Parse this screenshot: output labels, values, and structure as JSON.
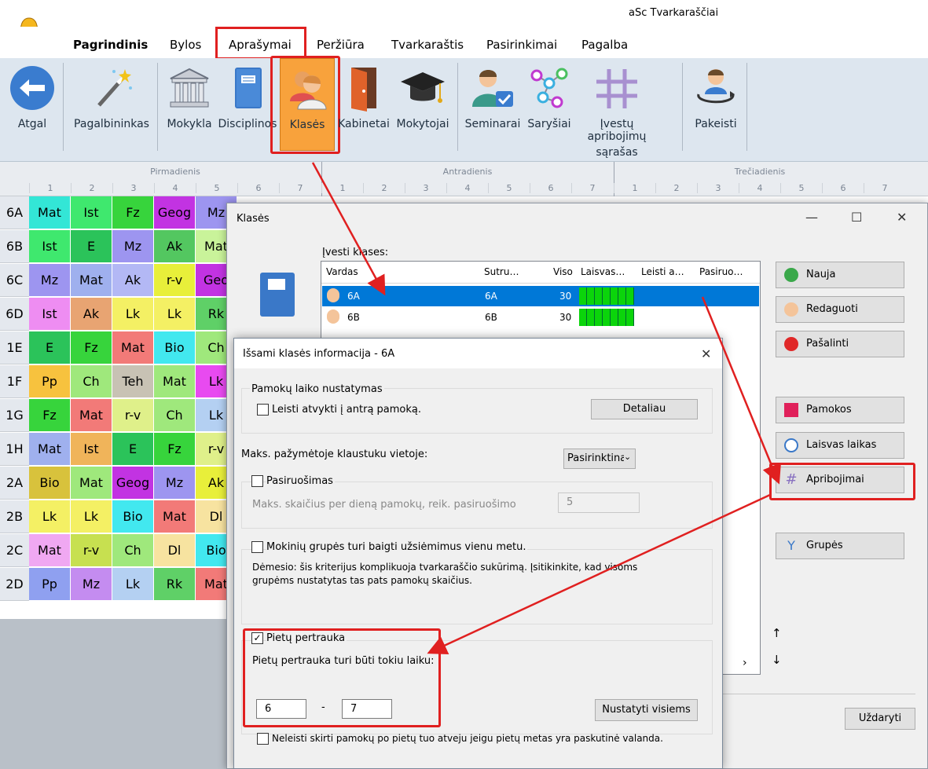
{
  "app": {
    "title": "aSc Tvarkaraščiai"
  },
  "menu": {
    "items": [
      "Pagrindinis",
      "Bylos",
      "Aprašymai",
      "Peržiūra",
      "Tvarkaraštis",
      "Pasirinkimai",
      "Pagalba"
    ]
  },
  "ribbon": {
    "back": "Atgal",
    "wizard": "Pagalbininkas",
    "school": "Mokykla",
    "subjects": "Disciplinos",
    "classes": "Klasės",
    "rooms": "Kabinetai",
    "teachers": "Mokytojai",
    "seminars": "Seminarai",
    "links": "Saryšiai",
    "constraints_line1": "Įvestų apribojimų",
    "constraints_line2": "sąrašas",
    "replace": "Pakeisti"
  },
  "grid": {
    "days": [
      "Pirmadienis",
      "Antradienis",
      "Trečiadienis"
    ],
    "periods": [
      "1",
      "2",
      "3",
      "4",
      "5",
      "6",
      "7"
    ],
    "rows": [
      {
        "cls": "6A",
        "cells": [
          {
            "t": "Mat",
            "c": "#33e6d6"
          },
          {
            "t": "Ist",
            "c": "#3fe86e"
          },
          {
            "t": "Fz",
            "c": "#37d43c"
          },
          {
            "t": "Geog",
            "c": "#c233e2"
          },
          {
            "t": "Mz",
            "c": "#9d95f0"
          }
        ]
      },
      {
        "cls": "6B",
        "cells": [
          {
            "t": "Ist",
            "c": "#3fe86e"
          },
          {
            "t": "E",
            "c": "#2bc35a"
          },
          {
            "t": "Mz",
            "c": "#9d95f0"
          },
          {
            "t": "Ak",
            "c": "#53c760"
          },
          {
            "t": "Mat",
            "c": "#c9f39a"
          }
        ]
      },
      {
        "cls": "6C",
        "cells": [
          {
            "t": "Mz",
            "c": "#9d95f0"
          },
          {
            "t": "Mat",
            "c": "#9fb0ee"
          },
          {
            "t": "Ak",
            "c": "#b3b8f5"
          },
          {
            "t": "r-v",
            "c": "#e8ef3a"
          },
          {
            "t": "Geo",
            "c": "#c233e2"
          }
        ]
      },
      {
        "cls": "6D",
        "cells": [
          {
            "t": "Ist",
            "c": "#ee8df2"
          },
          {
            "t": "Ak",
            "c": "#e8a472"
          },
          {
            "t": "Lk",
            "c": "#f4f064"
          },
          {
            "t": "Lk",
            "c": "#f4f064"
          },
          {
            "t": "Rk",
            "c": "#5fd067"
          }
        ]
      },
      {
        "cls": "1E",
        "cells": [
          {
            "t": "E",
            "c": "#2bc35a"
          },
          {
            "t": "Fz",
            "c": "#37d43c"
          },
          {
            "t": "Mat",
            "c": "#f27a78"
          },
          {
            "t": "Bio",
            "c": "#42e8ef"
          },
          {
            "t": "Ch",
            "c": "#9fe87c"
          }
        ]
      },
      {
        "cls": "1F",
        "cells": [
          {
            "t": "Pp",
            "c": "#f7c23e"
          },
          {
            "t": "Ch",
            "c": "#9fe87c"
          },
          {
            "t": "Teh",
            "c": "#c8c2b4"
          },
          {
            "t": "Mat",
            "c": "#9fe87c"
          },
          {
            "t": "Lk",
            "c": "#e84af0"
          }
        ]
      },
      {
        "cls": "1G",
        "cells": [
          {
            "t": "Fz",
            "c": "#37d43c"
          },
          {
            "t": "Mat",
            "c": "#f27a78"
          },
          {
            "t": "r-v",
            "c": "#dff08a"
          },
          {
            "t": "Ch",
            "c": "#9fe87c"
          },
          {
            "t": "Lk",
            "c": "#b4d0f2"
          }
        ]
      },
      {
        "cls": "1H",
        "cells": [
          {
            "t": "Mat",
            "c": "#9fb0ee"
          },
          {
            "t": "Ist",
            "c": "#f0b45a"
          },
          {
            "t": "E",
            "c": "#2bc35a"
          },
          {
            "t": "Fz",
            "c": "#37d43c"
          },
          {
            "t": "r-v",
            "c": "#dff08a"
          }
        ]
      },
      {
        "cls": "2A",
        "cells": [
          {
            "t": "Bio",
            "c": "#d8c23c"
          },
          {
            "t": "Mat",
            "c": "#9fe87c"
          },
          {
            "t": "Geog",
            "c": "#c233e2"
          },
          {
            "t": "Mz",
            "c": "#9d95f0"
          },
          {
            "t": "Ak",
            "c": "#e8ef3a"
          }
        ]
      },
      {
        "cls": "2B",
        "cells": [
          {
            "t": "Lk",
            "c": "#f4f064"
          },
          {
            "t": "Lk",
            "c": "#f4f064"
          },
          {
            "t": "Bio",
            "c": "#42e8ef"
          },
          {
            "t": "Mat",
            "c": "#f27a78"
          },
          {
            "t": "Dl",
            "c": "#f7e3a0"
          }
        ]
      },
      {
        "cls": "2C",
        "cells": [
          {
            "t": "Mat",
            "c": "#f0a8f2"
          },
          {
            "t": "r-v",
            "c": "#c7e050"
          },
          {
            "t": "Ch",
            "c": "#9fe87c"
          },
          {
            "t": "Dl",
            "c": "#f7e3a0"
          },
          {
            "t": "Bio",
            "c": "#42e8ef"
          }
        ]
      },
      {
        "cls": "2D",
        "cells": [
          {
            "t": "Pp",
            "c": "#8fa0f0"
          },
          {
            "t": "Mz",
            "c": "#c48cf0"
          },
          {
            "t": "Lk",
            "c": "#b4d0f2"
          },
          {
            "t": "Rk",
            "c": "#5fd067"
          },
          {
            "t": "Mat",
            "c": "#f27a78"
          }
        ]
      }
    ]
  },
  "classes_dialog": {
    "title": "Klasės",
    "list_label": "Įvesti klases:",
    "columns": [
      "Vardas",
      "Sutru…",
      "Viso",
      "Laisvas…",
      "Leisti a…",
      "Pasiruo…"
    ],
    "rows": [
      {
        "name": "6A",
        "short": "6A",
        "total": "30"
      },
      {
        "name": "6B",
        "short": "6B",
        "total": "30"
      }
    ],
    "buttons": {
      "new": "Nauja",
      "edit": "Redaguoti",
      "delete": "Pašalinti",
      "lessons": "Pamokos",
      "free_time": "Laisvas laikas",
      "constraints": "Apribojimai",
      "groups": "Grupės",
      "close": "Uždaryti"
    },
    "arrows": {
      "up": "↑",
      "down": "↓"
    }
  },
  "class_detail_dialog": {
    "title": "Išsami klasės informacija - 6A",
    "lesson_time_group": "Pamokų laiko nustatymas",
    "allow_late": "Leisti atvykti į antrą pamoką.",
    "details_button": "Detaliau",
    "max_marked_label": "Maks. pažymėtoje klaustuku vietoje:",
    "max_marked_value": "Pasirinktinai",
    "preparation_label": "Pasiruošimas",
    "preparation_max_label": "Maks. skaičius per dieną pamokų, reik. pasiruošimo",
    "preparation_max_value": "5",
    "groups_end_label": "Mokinių grupės turi baigti užsiėmimus vienu metu.",
    "warning_line1": "Dėmesio: šis kriterijus komplikuoja tvarkaraščio sukūrimą. Įsitikinkite, kad visoms",
    "warning_line2": "grupėms nustatytas tas pats pamokų skaičius.",
    "lunch_label": "Pietų pertrauka",
    "lunch_time_label": "Pietų pertrauka turi būti tokiu laiku:",
    "lunch_from": "6",
    "lunch_dash": "-",
    "lunch_to": "7",
    "set_all_button": "Nustatyti visiems",
    "no_after_lunch": "Neleisti skirti pamokų po pietų tuo atveju jeigu pietų metas yra paskutinė valanda."
  }
}
